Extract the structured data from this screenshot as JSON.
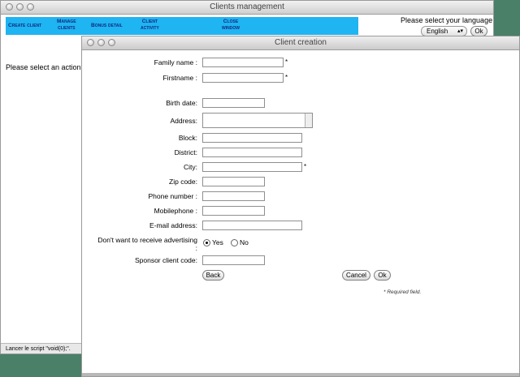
{
  "main_window": {
    "title": "Clients management",
    "menu": [
      {
        "line1": "Create client",
        "line2": ""
      },
      {
        "line1": "Manage",
        "line2": "clients"
      },
      {
        "line1": "Bonus detail",
        "line2": ""
      },
      {
        "line1": "Client",
        "line2": "activity"
      },
      {
        "line1": "Close",
        "line2": "window"
      }
    ],
    "language_label": "Please select your language",
    "language_selected": "English",
    "language_ok": "Ok",
    "prompt": "Please select an action",
    "status": "Lancer le script \"void(0);\"."
  },
  "dialog": {
    "title": "Client creation",
    "fields": {
      "family_name": "Family name :",
      "firstname": "Firstname :",
      "birth_date": "Birth date:",
      "address": "Address:",
      "block": "Block:",
      "district": "District:",
      "city": "City:",
      "zip_code": "Zip code:",
      "phone_number": "Phone number :",
      "mobilephone": "Mobilephone :",
      "email": "E-mail address:",
      "advertising_line1": "Don't want to receive advertising",
      "advertising_line2": ":",
      "sponsor_code": "Sponsor client code:"
    },
    "required_mark": "*",
    "radio_yes": "Yes",
    "radio_no": "No",
    "advertising_value": "Yes",
    "back": "Back",
    "cancel": "Cancel",
    "ok": "Ok",
    "required_note": "* Required field."
  }
}
